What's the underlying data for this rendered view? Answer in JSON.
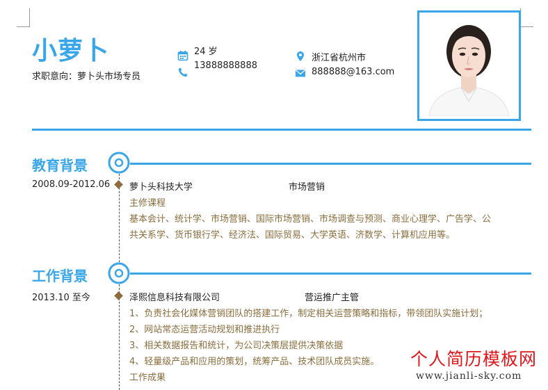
{
  "header": {
    "name": "小萝卜",
    "intent": "求职意向：萝卜头市场专员",
    "age": "24 岁",
    "phone": "13888888888",
    "location": "浙江省杭州市",
    "email": "888888@163.com"
  },
  "sections": {
    "education": {
      "title": "教育背景",
      "date": "2008.09-2012.06",
      "school": "萝卜头科技大学",
      "major": "市场营销",
      "courses_label": "主修课程",
      "courses_line1": "基本会计、统计学、市场营销、国际市场营销、市场调查与预测、商业心理学、广告学、公",
      "courses_line2": "共关系学、货币银行学、经济法、国际贸易、大学英语、济数学、计算机应用等。"
    },
    "work": {
      "title": "工作背景",
      "date": "2013.10 至今",
      "company": "泽熙信息科技有限公司",
      "position": "营运推广主管",
      "duties": [
        "1、负责社会化媒体营销团队的搭建工作，制定相关运营策略和指标，带领团队实施计划；",
        "2、网站常态运营活动规划和推进执行",
        "3、相关数据报告和统计，为公司决策层提供决策依据",
        "4、轻量级产品和应用的策划，统筹产品、技术团队成员实施。"
      ],
      "results_label": "工作成果"
    }
  },
  "watermark": {
    "title": "个人简历模板网",
    "url": "www.jianli-sky.com"
  },
  "colors": {
    "accent": "#3aa6ea",
    "brown": "#8b6d3d",
    "watermark_red": "#e0161b"
  },
  "icons": {
    "age": "calendar-icon",
    "phone": "phone-icon",
    "location": "location-pin-icon",
    "email": "envelope-icon"
  }
}
